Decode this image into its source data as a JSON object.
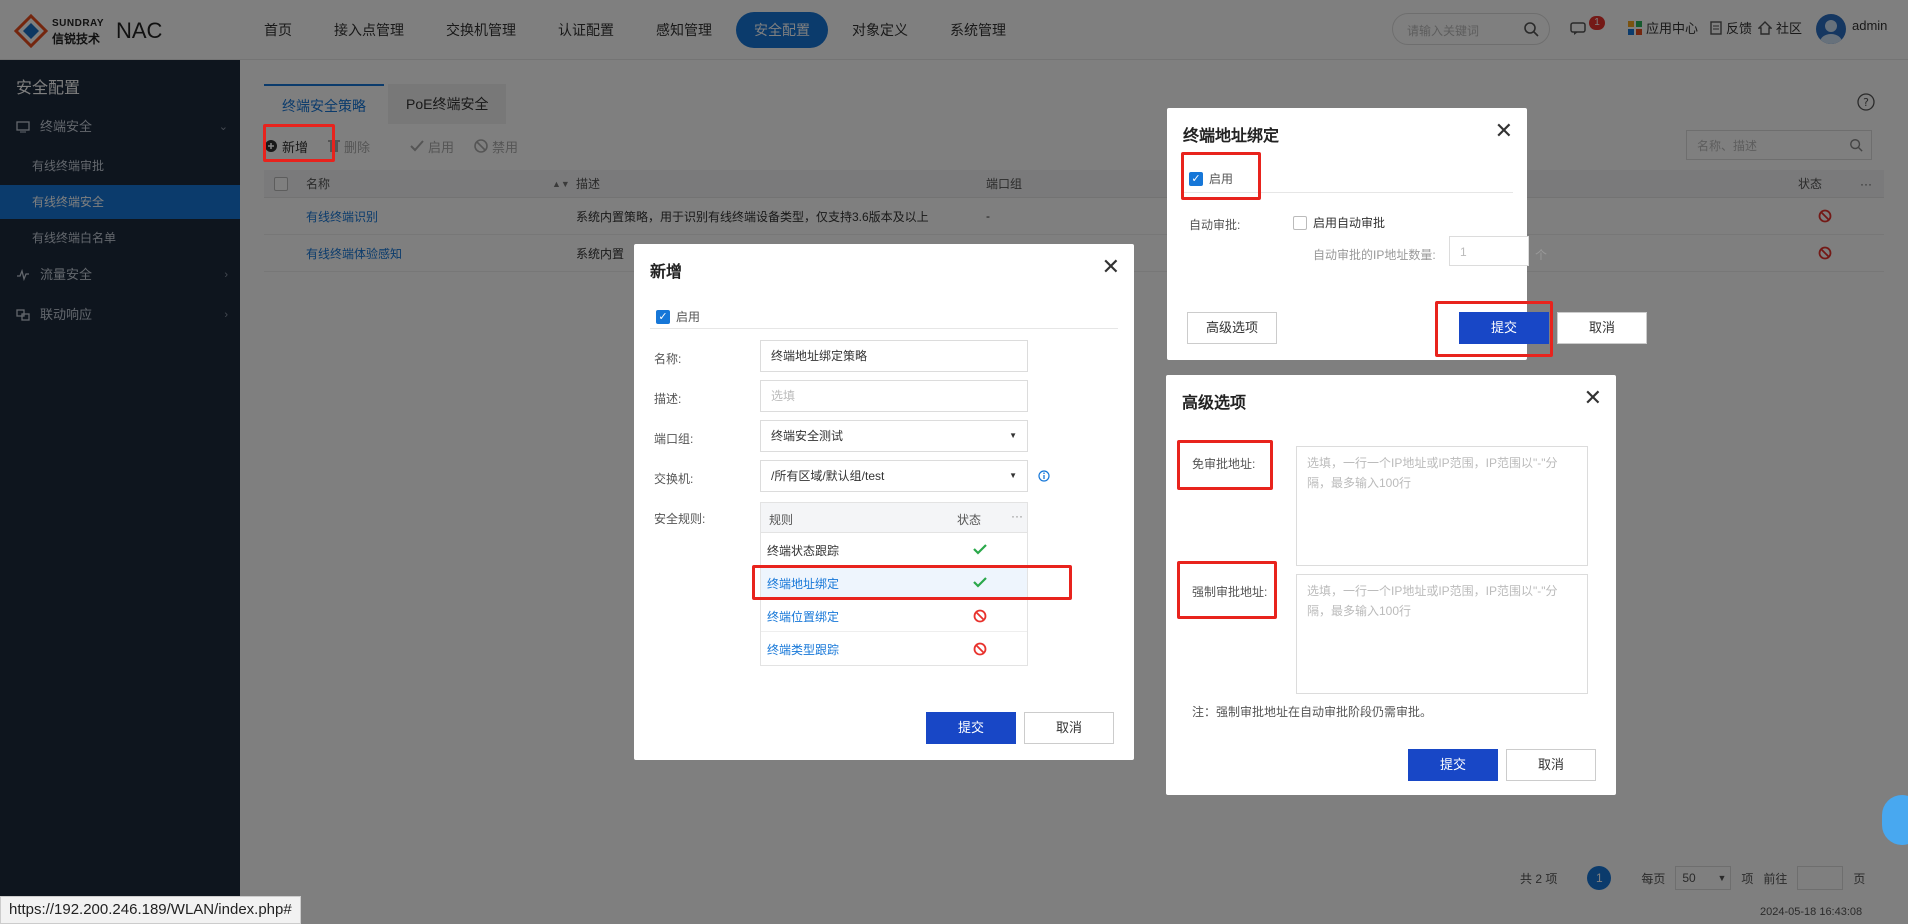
{
  "header": {
    "brand_small": "SUNDRAY",
    "brand_cn": "信锐技术",
    "app_title": "NAC",
    "nav": [
      "首页",
      "接入点管理",
      "交换机管理",
      "认证配置",
      "感知管理",
      "安全配置",
      "对象定义",
      "系统管理"
    ],
    "active_nav": "安全配置",
    "search_placeholder": "请输入关键词",
    "notification_count": "1",
    "app_center": "应用中心",
    "feedback": "反馈",
    "community": "社区",
    "user": "admin"
  },
  "sidebar": {
    "title": "安全配置",
    "groups": [
      {
        "label": "终端安全",
        "icon": "terminal-security-icon",
        "items": [
          "有线终端审批",
          "有线终端安全",
          "有线终端白名单"
        ]
      },
      {
        "label": "流量安全",
        "icon": "traffic-security-icon"
      },
      {
        "label": "联动响应",
        "icon": "linkage-icon"
      }
    ],
    "selected": "有线终端安全"
  },
  "main": {
    "tabs": [
      "终端安全策略",
      "PoE终端安全"
    ],
    "toolbar": {
      "add": "新增",
      "delete": "删除",
      "enable": "启用",
      "disable": "禁用"
    },
    "filter_placeholder": "名称、描述",
    "columns": {
      "name": "名称",
      "desc": "描述",
      "port_group": "端口组",
      "status": "状态"
    },
    "rows": [
      {
        "name": "有线终端识别",
        "desc": "系统内置策略，用于识别有线终端设备类型，仅支持3.6版本及以上",
        "port_group": "-"
      },
      {
        "name": "有线终端体验感知",
        "desc": "系统内置"
      }
    ],
    "pager": {
      "total": "共 2 项",
      "page": "1",
      "per_page_label": "每页",
      "per_page": "50",
      "unit": "项",
      "goto": "前往",
      "page_unit": "页"
    },
    "datetime": "2024-05-18 16:43:08"
  },
  "dialog_add": {
    "title": "新增",
    "enable": "启用",
    "name_label": "名称:",
    "name_value": "终端地址绑定策略",
    "desc_label": "描述:",
    "desc_placeholder": "选填",
    "port_group_label": "端口组:",
    "port_group_value": "终端安全测试",
    "switch_label": "交换机:",
    "switch_value": "/所有区域/默认组/test",
    "rules_label": "安全规则:",
    "rules_header": {
      "rule": "规则",
      "status": "状态"
    },
    "rules": [
      {
        "name": "终端状态跟踪",
        "status": "enabled"
      },
      {
        "name": "终端地址绑定",
        "status": "enabled"
      },
      {
        "name": "终端位置绑定",
        "status": "disabled"
      },
      {
        "name": "终端类型跟踪",
        "status": "disabled"
      }
    ],
    "submit": "提交",
    "cancel": "取消"
  },
  "dialog_bind": {
    "title": "终端地址绑定",
    "enable": "启用",
    "auto_label": "自动审批:",
    "auto_check": "启用自动审批",
    "count_label": "自动审批的IP地址数量:",
    "count_value": "1",
    "count_unit": "个",
    "advanced": "高级选项",
    "submit": "提交",
    "cancel": "取消"
  },
  "dialog_adv": {
    "title": "高级选项",
    "exempt_label": "免审批地址:",
    "exempt_placeholder": "选填，一行一个IP地址或IP范围，IP范围以\"-\"分隔，最多输入100行",
    "force_label": "强制审批地址:",
    "force_placeholder": "选填，一行一个IP地址或IP范围，IP范围以\"-\"分隔，最多输入100行",
    "note": "注：强制审批地址在自动审批阶段仍需审批。",
    "submit": "提交",
    "cancel": "取消"
  },
  "status_url": "https://192.200.246.189/WLAN/index.php#",
  "colors": {
    "primary": "#1677d8",
    "primary_dark": "#1847c6",
    "highlight": "#e8231d",
    "sidebar": "#1d2a3c"
  }
}
